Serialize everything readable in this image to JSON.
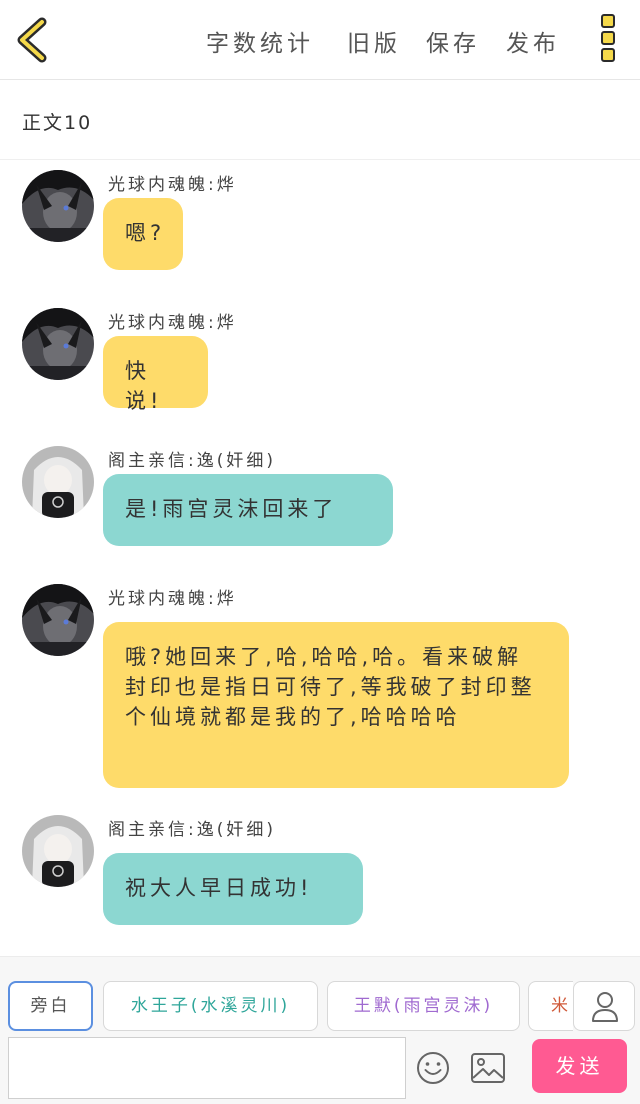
{
  "header": {
    "word_count_label": "字数统计",
    "old_version_label": "旧版",
    "save_label": "保存",
    "publish_label": "发布"
  },
  "section_title": "正文10",
  "messages": [
    {
      "sender": "光球内魂魄:烨",
      "text": "嗯?",
      "color": "#fedb6a"
    },
    {
      "sender": "光球内魂魄:烨",
      "text": "快说!",
      "color": "#fedb6a"
    },
    {
      "sender": "阁主亲信:逸(奸细)",
      "text": "是!雨宫灵沫回来了",
      "color": "#8cd7d1"
    },
    {
      "sender": "光球内魂魄:烨",
      "text": "哦?她回来了,哈,哈哈,哈。看来破解封印也是指日可待了,等我破了封印整个仙境就都是我的了,哈哈哈哈",
      "color": "#fedb6a"
    },
    {
      "sender": "阁主亲信:逸(奸细)",
      "text": "祝大人早日成功!",
      "color": "#8cd7d1"
    }
  ],
  "roles": [
    {
      "label": "旁白",
      "color": "#555555"
    },
    {
      "label": "水王子(水溪灵川)",
      "color": "#2fa69a"
    },
    {
      "label": "王默(雨宫灵沫)",
      "color": "#a06ad0"
    },
    {
      "label": "米",
      "color": "#d05a3a"
    }
  ],
  "input": {
    "value": "",
    "placeholder": ""
  },
  "send_label": "发送",
  "icons": {
    "back": "chevron-left-icon",
    "menu": "more-vertical-icon",
    "role": "user-icon",
    "emoji": "smiley-icon",
    "image": "image-icon"
  }
}
